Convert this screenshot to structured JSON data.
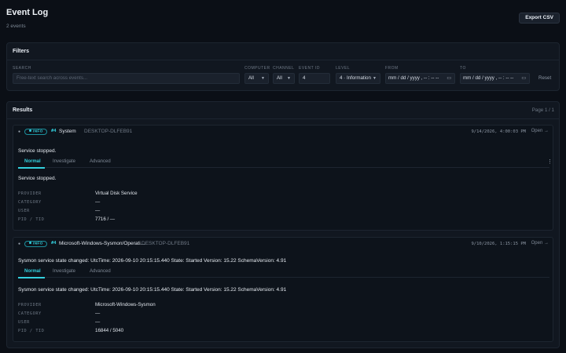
{
  "header": {
    "title": "Event Log",
    "count": "2 events",
    "export_label": "Export CSV"
  },
  "filters": {
    "title": "Filters",
    "search_label": "SEARCH",
    "search_placeholder": "Free-text search across events...",
    "computer_label": "COMPUTER",
    "computer_value": "All",
    "channel_label": "CHANNEL",
    "channel_value": "All",
    "event_id_label": "EVENT ID",
    "event_id_value": "4",
    "level_label": "LEVEL",
    "level_value": "4 · Information",
    "from_label": "FROM",
    "from_value": "mm / dd / yyyy ,  -- : --  --",
    "to_label": "TO",
    "to_value": "mm / dd / yyyy ,  -- : --  --",
    "reset_label": "Reset"
  },
  "results": {
    "title": "Results",
    "page": "Page 1 / 1",
    "tabs": [
      "Normal",
      "Investigate",
      "Advanced"
    ],
    "keys": [
      "PROVIDER",
      "CATEGORY",
      "USER",
      "PID / TID"
    ],
    "open_label": "Open →",
    "events": [
      {
        "level": "INFO",
        "event_id": "#4",
        "channel": "System",
        "computer": "DESKTOP-DLFEB91",
        "timestamp": "9/14/2026, 4:00:03 PM",
        "summary": "Service stopped.",
        "message": "Service stopped.",
        "provider": "Virtual Disk Service",
        "category": "—",
        "user": "—",
        "pid_tid": "7716 / —"
      },
      {
        "level": "INFO",
        "event_id": "#4",
        "channel": "Microsoft-Windows-Sysmon/Operati…",
        "computer": "DESKTOP-DLFEB91",
        "timestamp": "9/10/2026, 1:15:15 PM",
        "summary": "Sysmon service state changed: UtcTime: 2026-09-10 20:15:15.440 State: Started Version: 15.22 SchemaVersion: 4.91",
        "message": "Sysmon service state changed: UtcTime: 2026-09-10 20:15:15.440 State: Started Version: 15.22 SchemaVersion: 4.91",
        "provider": "Microsoft-Windows-Sysmon",
        "category": "—",
        "user": "—",
        "pid_tid": "16844 / 5040"
      }
    ]
  },
  "colors": {
    "background": "#0b0f16",
    "panel": "#111720",
    "accent": "#33d0de"
  }
}
